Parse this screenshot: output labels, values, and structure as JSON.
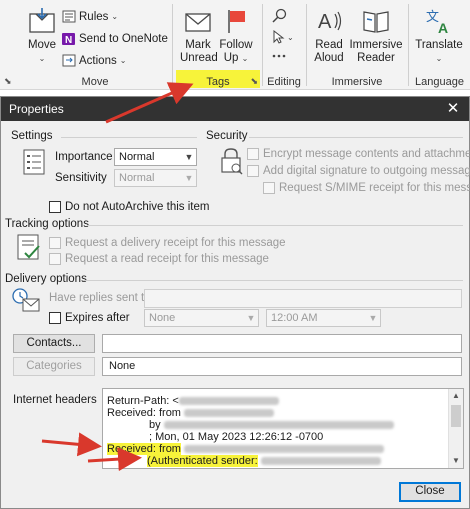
{
  "ribbon": {
    "move": {
      "move_label": "Move",
      "rules_label": "Rules",
      "send_onenote_label": "Send to OneNote",
      "actions_label": "Actions",
      "group_label": "Move"
    },
    "tags": {
      "mark_unread_line1": "Mark",
      "mark_unread_line2": "Unread",
      "follow_up_line1": "Follow",
      "follow_up_line2": "Up",
      "group_label": "Tags"
    },
    "editing": {
      "group_label": "Editing"
    },
    "immersive": {
      "read_aloud_line1": "Read",
      "read_aloud_line2": "Aloud",
      "immersive_reader_line1": "Immersive",
      "immersive_reader_line2": "Reader",
      "group_label": "Immersive"
    },
    "language": {
      "translate_label": "Translate",
      "group_label": "Language"
    }
  },
  "dialog": {
    "title": "Properties",
    "settings": {
      "section_label": "Settings",
      "importance_label": "Importance",
      "importance_value": "Normal",
      "sensitivity_label": "Sensitivity",
      "sensitivity_value": "Normal",
      "autoarchive_label": "Do not AutoArchive this item"
    },
    "security": {
      "section_label": "Security",
      "encrypt_label": "Encrypt message contents and attachments",
      "signature_label": "Add digital signature to outgoing message",
      "smime_label": "Request S/MIME receipt for this message"
    },
    "tracking": {
      "section_label": "Tracking options",
      "delivery_receipt_label": "Request a delivery receipt for this message",
      "read_receipt_label": "Request a read receipt for this message"
    },
    "delivery": {
      "section_label": "Delivery options",
      "replies_label": "Have replies sent to",
      "expires_label": "Expires after",
      "expires_date": "None",
      "expires_time": "12:00 AM"
    },
    "contacts_button": "Contacts...",
    "categories_button": "Categories",
    "categories_value": "None",
    "headers": {
      "label": "Internet headers",
      "line1": "Return-Path: <",
      "line2": "Received: from",
      "line3": "by",
      "line4": "; Mon, 01 May 2023 12:26:12 -0700",
      "line5": "Received: from",
      "line6": "(Authenticated sender:"
    },
    "close_button": "Close"
  },
  "colors": {
    "highlight": "#f7f33a",
    "annotation_arrow": "#d9382c",
    "titlebar": "#323232",
    "accent": "#0078d7"
  }
}
